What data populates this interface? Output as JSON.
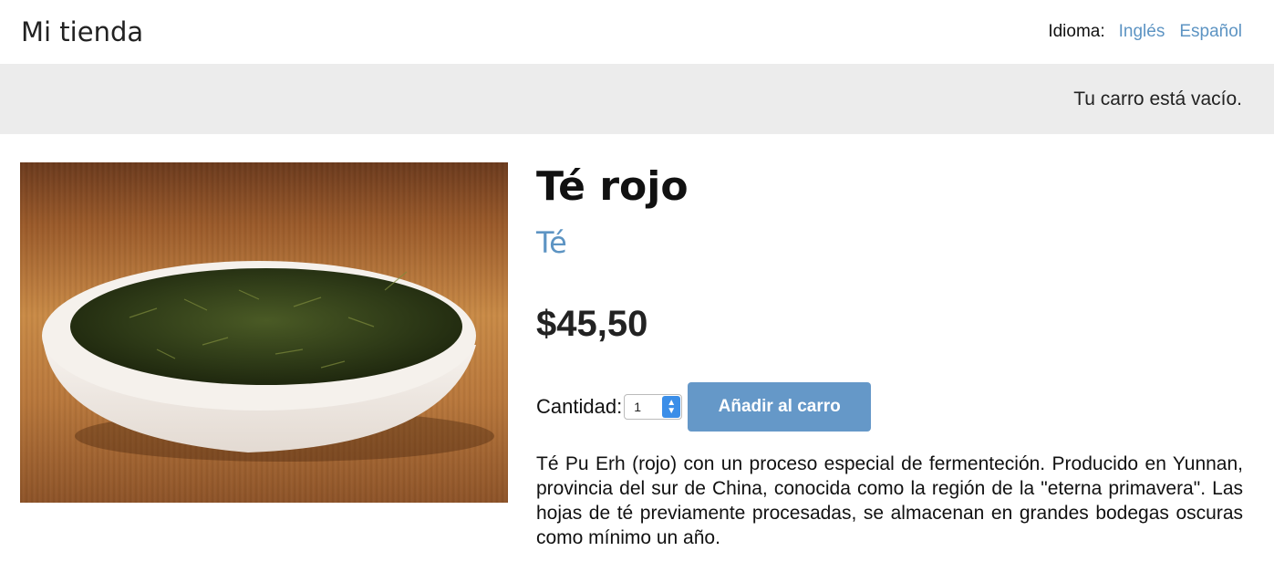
{
  "header": {
    "logo": "Mi tienda",
    "language_label": "Idioma:",
    "languages": [
      "Inglés",
      "Español"
    ]
  },
  "cart": {
    "status": "Tu carro está vacío."
  },
  "product": {
    "image_icon": "tea-bowl-photo",
    "name": "Té rojo",
    "category": "Té",
    "price": "$45,50",
    "quantity_label": "Cantidad:",
    "quantity_value": "1",
    "add_button": "Añadir al carro",
    "description": "Té Pu Erh (rojo) con un proceso especial de fermenteción. Producido en Yunnan, provincia del sur de China, conocida como la región de la \"eterna primavera\". Las hojas de té previamente procesadas, se almacenan en grandes bodegas oscuras como mínimo un año."
  },
  "colors": {
    "link": "#5d94c3",
    "button": "#6598c8",
    "cartbar_bg": "#ececec"
  }
}
